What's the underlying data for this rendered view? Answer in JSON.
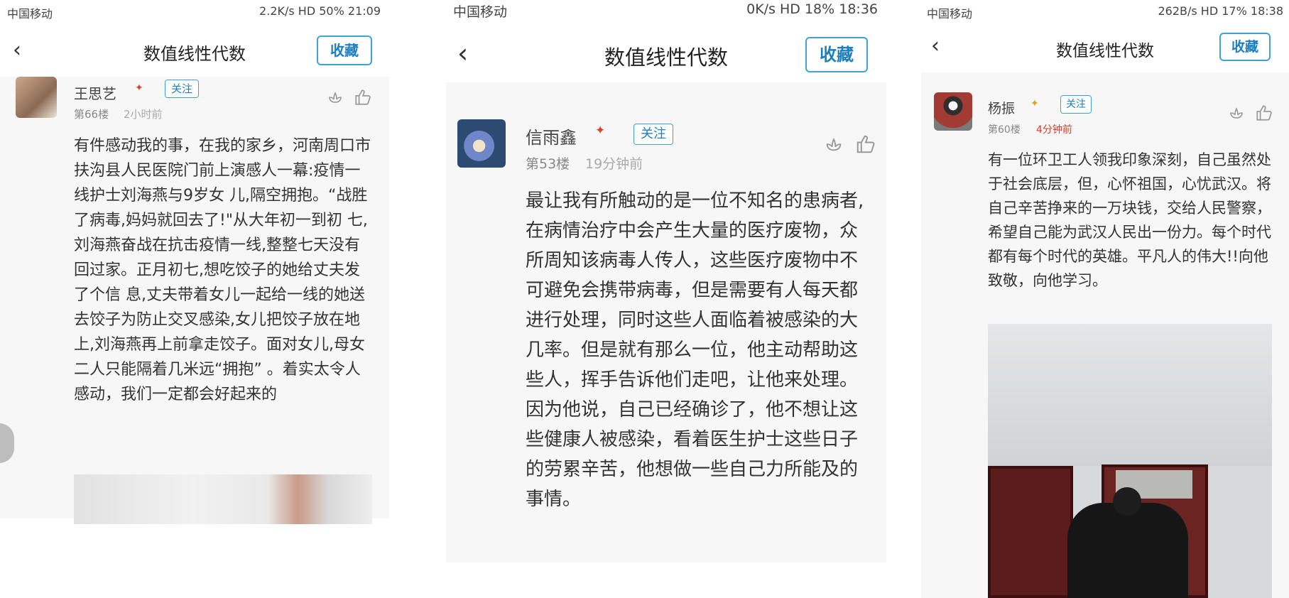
{
  "screens": [
    {
      "status": {
        "carrier": "中国移动",
        "right": "2.2K/s  HD  50%  21:09"
      },
      "nav": {
        "title": "数值线性代数",
        "collect": "收藏"
      },
      "post": {
        "name": "王思艺",
        "follow": "关注",
        "floor": "第66楼",
        "time": "2小时前",
        "text": "有件感动我的事，在我的家乡，河南周口市扶沟县人民医院门前上演感人一幕:疫情一线护士刘海燕与9岁女 儿,隔空拥抱。“战胜了病毒,妈妈就回去了!\"从大年初一到初 七,刘海燕奋战在抗击疫情一线,整整七天没有回过家。正月初七,想吃饺子的她给丈夫发了个信 息,丈夫带着女儿一起给一线的她送去饺子为防止交叉感染,女儿把饺子放在地上,刘海燕再上前拿走饺子。面对女儿,母女二人只能隔着几米远“拥抱” 。着实太令人感动，我们一定都会好起来的"
      }
    },
    {
      "status": {
        "carrier": "中国移动",
        "right": "0K/s  HD  18%  18:36"
      },
      "nav": {
        "title": "数值线性代数",
        "collect": "收藏"
      },
      "post": {
        "name": "信雨鑫",
        "follow": "关注",
        "floor": "第53楼",
        "time": "19分钟前",
        "text": "最让我有所触动的是一位不知名的患病者,在病情治疗中会产生大量的医疗废物，众所周知该病毒人传人，这些医疗废物中不可避免会携带病毒，但是需要有人每天都进行处理，同时这些人面临着被感染的大几率。但是就有那么一位，他主动帮助这些人，挥手告诉他们走吧，让他来处理。因为他说，自己已经确诊了，他不想让这些健康人被感染，看着医生护士这些日子的劳累辛苦，他想做一些自己力所能及的事情。"
      }
    },
    {
      "status": {
        "carrier": "中国移动",
        "right": "262B/s  HD  17%  18:38"
      },
      "nav": {
        "title": "数值线性代数",
        "collect": "收藏"
      },
      "post": {
        "name": "杨振",
        "follow": "关注",
        "floor": "第60楼",
        "time": "4分钟前",
        "text": "有一位环卫工人领我印象深刻，自己虽然处于社会底层，但，心怀祖国，心忧武汉。将自己辛苦挣来的一万块钱，交给人民警察，希望自己能为武汉人民出一份力。每个时代都有每个时代的英雄。平凡人的伟大!!向他致敬，向他学习。"
      }
    }
  ],
  "colors": {
    "accent": "#3fa1d8",
    "time_red": "#e23b2e"
  }
}
